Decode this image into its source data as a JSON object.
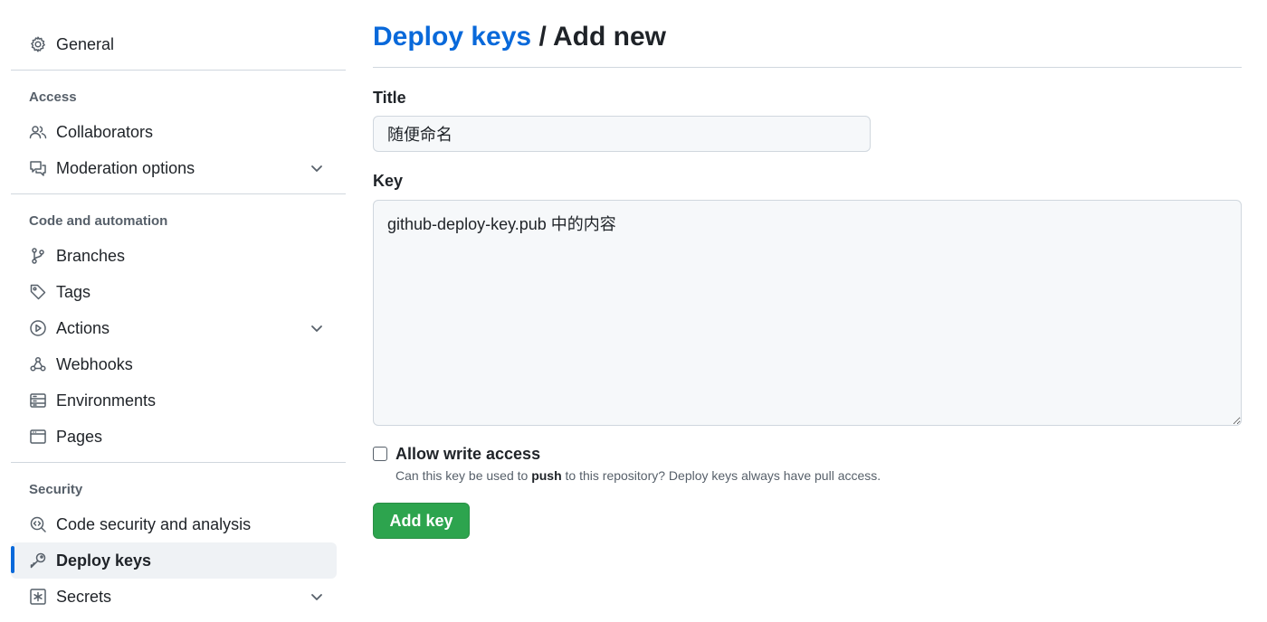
{
  "sidebar": {
    "general": "General",
    "access_title": "Access",
    "collaborators": "Collaborators",
    "moderation": "Moderation options",
    "code_title": "Code and automation",
    "branches": "Branches",
    "tags": "Tags",
    "actions": "Actions",
    "webhooks": "Webhooks",
    "environments": "Environments",
    "pages": "Pages",
    "security_title": "Security",
    "code_security": "Code security and analysis",
    "deploy_keys": "Deploy keys",
    "secrets": "Secrets"
  },
  "main": {
    "breadcrumb_link": "Deploy keys",
    "breadcrumb_sep": "/",
    "breadcrumb_current": "Add new",
    "title_label": "Title",
    "title_value": "随便命名",
    "key_label": "Key",
    "key_value": "github-deploy-key.pub 中的内容",
    "write_access_label": "Allow write access",
    "note_before": "Can this key be used to ",
    "note_bold": "push",
    "note_after": " to this repository? Deploy keys always have pull access.",
    "add_button": "Add key"
  },
  "colors": {
    "accent": "#0969da",
    "button_green": "#2da44e",
    "muted": "#57606a"
  },
  "icons": {
    "general": "gear-icon",
    "collaborators": "people-icon",
    "moderation": "comment-discussion-icon",
    "branches": "git-branch-icon",
    "tags": "tag-icon",
    "actions": "play-icon",
    "webhooks": "webhook-icon",
    "environments": "server-icon",
    "pages": "browser-icon",
    "code_security": "codescan-icon",
    "deploy_keys": "key-icon",
    "secrets": "asterisk-icon"
  }
}
